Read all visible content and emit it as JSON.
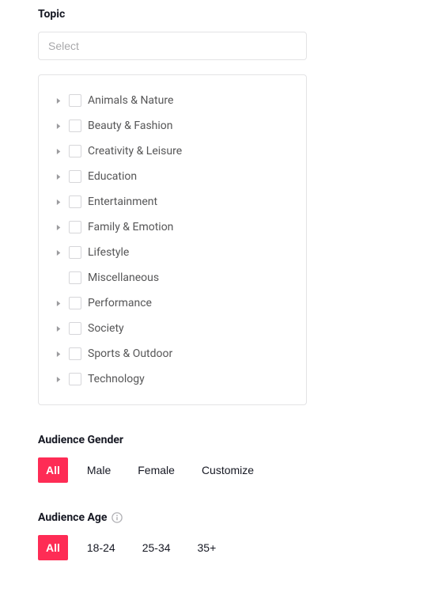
{
  "topic": {
    "title": "Topic",
    "select_placeholder": "Select",
    "items": [
      {
        "label": "Animals & Nature",
        "expandable": true
      },
      {
        "label": "Beauty & Fashion",
        "expandable": true
      },
      {
        "label": "Creativity & Leisure",
        "expandable": true
      },
      {
        "label": "Education",
        "expandable": true
      },
      {
        "label": "Entertainment",
        "expandable": true
      },
      {
        "label": "Family & Emotion",
        "expandable": true
      },
      {
        "label": "Lifestyle",
        "expandable": true
      },
      {
        "label": "Miscellaneous",
        "expandable": false
      },
      {
        "label": "Performance",
        "expandable": true
      },
      {
        "label": "Society",
        "expandable": true
      },
      {
        "label": "Sports & Outdoor",
        "expandable": true
      },
      {
        "label": "Technology",
        "expandable": true
      }
    ]
  },
  "gender": {
    "title": "Audience Gender",
    "options": [
      {
        "label": "All",
        "active": true
      },
      {
        "label": "Male",
        "active": false
      },
      {
        "label": "Female",
        "active": false
      },
      {
        "label": "Customize",
        "active": false
      }
    ]
  },
  "age": {
    "title": "Audience Age",
    "options": [
      {
        "label": "All",
        "active": true
      },
      {
        "label": "18-24",
        "active": false
      },
      {
        "label": "25-34",
        "active": false
      },
      {
        "label": "35+",
        "active": false
      }
    ]
  },
  "colors": {
    "accent": "#fe2c55"
  }
}
